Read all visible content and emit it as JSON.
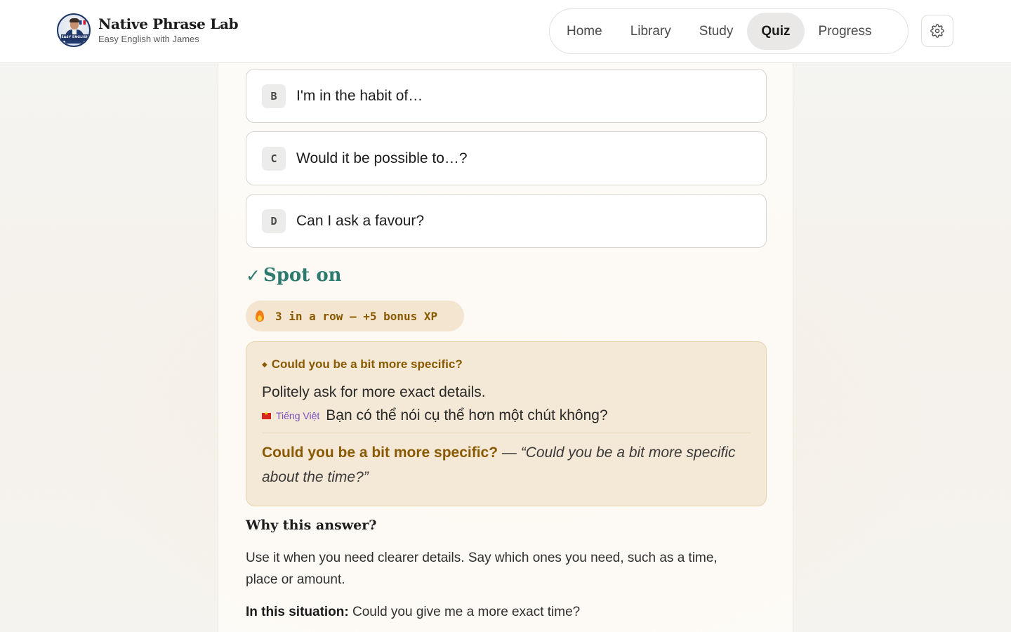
{
  "header": {
    "brand_title": "Native Phrase Lab",
    "brand_subtitle": "Easy English with James",
    "avatar_badge": "EASY ENGLISH",
    "avatar_name": "JAMES",
    "nav": [
      {
        "label": "Home",
        "active": false
      },
      {
        "label": "Library",
        "active": false
      },
      {
        "label": "Study",
        "active": false
      },
      {
        "label": "Quiz",
        "active": true
      },
      {
        "label": "Progress",
        "active": false
      }
    ],
    "settings_icon": "gear-icon"
  },
  "quiz": {
    "options": [
      {
        "letter": "B",
        "text": "I'm in the habit of…"
      },
      {
        "letter": "C",
        "text": "Would it be possible to…?"
      },
      {
        "letter": "D",
        "text": "Can I ask a favour?"
      }
    ],
    "result": {
      "check_icon": "✓",
      "label": "Spot on",
      "color": "#2c7a6d"
    },
    "streak": {
      "icon": "flame-icon",
      "text": "3 in a row — +5 bonus XP"
    },
    "phrase_card": {
      "phrase": "Could you be a bit more specific?",
      "meaning": "Politely ask for more exact details.",
      "translation_language": "Tiếng Việt",
      "translation": "Bạn có thể nói cụ thể hơn một chút không?",
      "example_phrase": "Could you be a bit more specific?",
      "example_separator": " — ",
      "example_quote": "“Could you be a bit more specific about the time?”"
    },
    "why": {
      "title": "Why this answer?",
      "text": "Use it when you need clearer details. Say which ones you need, such as a time, place or amount.",
      "situation_label": "In this situation:",
      "situation_text": "Could you give me a more exact time?"
    }
  }
}
